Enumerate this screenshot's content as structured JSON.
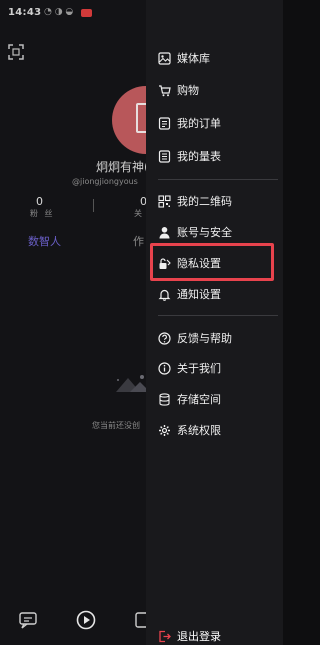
{
  "status_bar": {
    "time": "14:43",
    "battery": "29",
    "accent_badge": "#d23a3a"
  },
  "profile": {
    "nickname": "炯炯有神(",
    "handle": "@jiongjiongyous",
    "fans": {
      "count": "0",
      "label": "粉 丝"
    },
    "following": {
      "count": "0",
      "label": "关"
    },
    "tabs": [
      {
        "label": "数智人",
        "color": "#6a5fc7"
      },
      {
        "label": "作"
      }
    ],
    "empty_text": "您当前还没创",
    "avatar_color": "#b8575a"
  },
  "drawer": {
    "items": [
      {
        "label": "媒体库",
        "icon": "image-icon"
      },
      {
        "label": "购物",
        "icon": "cart-icon"
      },
      {
        "label": "我的订单",
        "icon": "list-icon"
      },
      {
        "label": "我的量表",
        "icon": "document-icon"
      },
      {
        "label": "我的二维码",
        "icon": "qrcode-icon"
      },
      {
        "label": "账号与安全",
        "icon": "person-icon"
      },
      {
        "label": "隐私设置",
        "icon": "privacy-lock-icon"
      },
      {
        "label": "通知设置",
        "icon": "bell-icon"
      },
      {
        "label": "反馈与帮助",
        "icon": "question-icon"
      },
      {
        "label": "关于我们",
        "icon": "info-icon"
      },
      {
        "label": "存储空间",
        "icon": "database-icon"
      },
      {
        "label": "系统权限",
        "icon": "gear-icon"
      }
    ],
    "logout": {
      "label": "退出登录",
      "icon": "logout-icon"
    },
    "highlight_color": "#e8434d"
  }
}
